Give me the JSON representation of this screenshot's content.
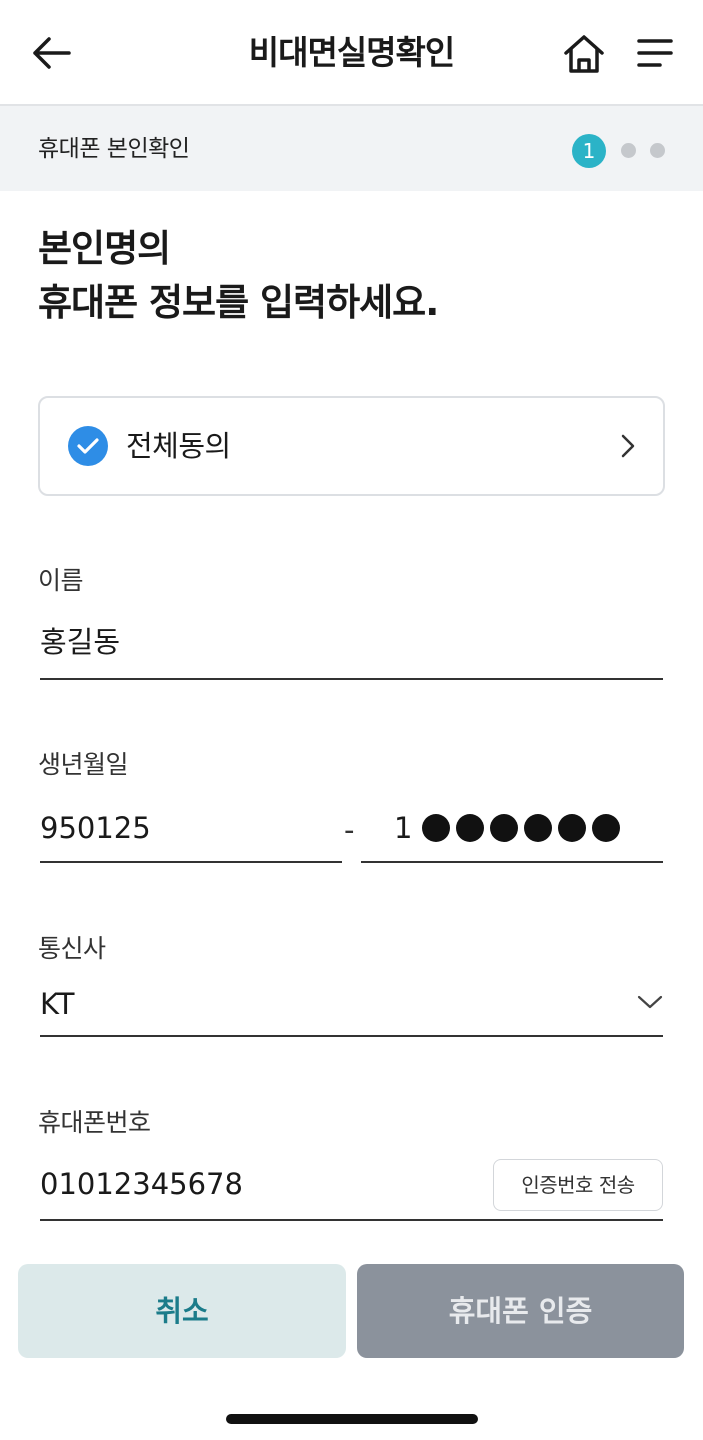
{
  "header": {
    "title": "비대면실명확인",
    "back_icon": "arrow-left-icon",
    "home_icon": "home-icon",
    "menu_icon": "hamburger-menu-icon"
  },
  "step": {
    "label": "휴대폰 본인확인",
    "current": "1",
    "total": 3,
    "active_color": "#2bb3c7"
  },
  "heading": {
    "line1": "본인명의",
    "line2": "휴대폰 정보를 입력하세요."
  },
  "agreement": {
    "label": "전체동의",
    "checked": true,
    "check_color": "#2e8de6"
  },
  "form": {
    "name": {
      "label": "이름",
      "value": "홍길동"
    },
    "birth": {
      "label": "생년월일",
      "value": "950125",
      "separator": "-",
      "gender_digit": "1",
      "masked_count": 6
    },
    "carrier": {
      "label": "통신사",
      "value": "KT"
    },
    "phone": {
      "label": "휴대폰번호",
      "value": "01012345678",
      "send_button": "인증번호 전송"
    }
  },
  "actions": {
    "cancel": "취소",
    "verify": "휴대폰 인증",
    "cancel_bg": "#dce9ea",
    "cancel_fg": "#1b7c8a",
    "verify_bg": "#8b929c"
  }
}
